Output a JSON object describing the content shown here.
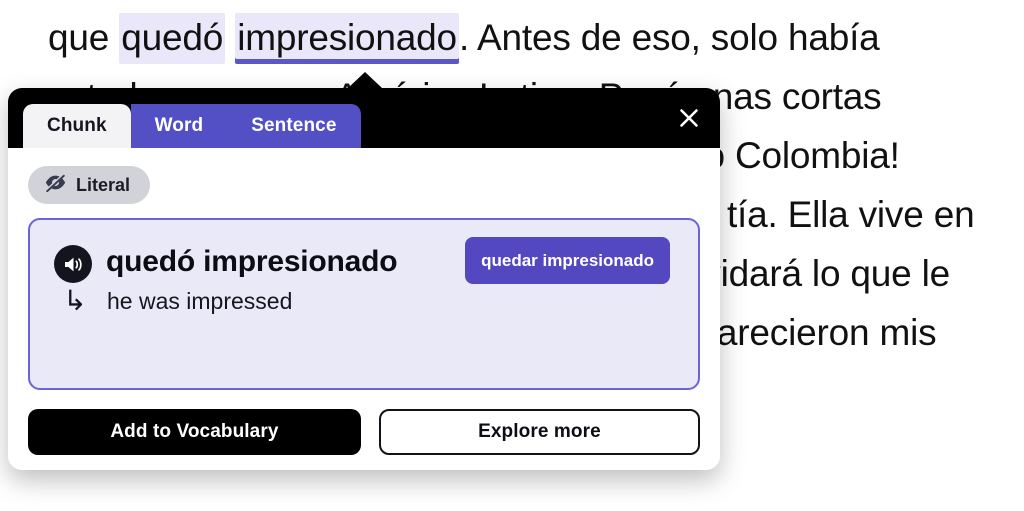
{
  "reader": {
    "segments": [
      {
        "text": "que ",
        "style": "plain"
      },
      {
        "text": "quedó",
        "style": "highlight"
      },
      {
        "text": " ",
        "style": "plain"
      },
      {
        "text": "impresionado",
        "style": "highlight-underline"
      },
      {
        "text": ". Antes de eso, solo había estado una vez a América Latina. Pasó unas cortas vacaciones en las playas de Tulum. ¡Pero Colombia! Cuando llegamos, fuimos a la casa de su tía. Ella vive en una región muy bella del país. ¡Nunca olvidará lo que le esperaba! Apenas llegamos a la casa, aparecieron mis",
        "style": "plain"
      }
    ],
    "highlight_color": "#e9e7f9",
    "underline_color": "#5b57c9"
  },
  "popup": {
    "header": {
      "tabs": [
        {
          "label": "Chunk",
          "active": true
        },
        {
          "label": "Word",
          "active": false
        },
        {
          "label": "Sentence",
          "active": false
        }
      ],
      "close_label": "✕",
      "background_color": "#000000",
      "tab_color": "#534fc4",
      "active_tab_color": "#f3f3f6"
    },
    "literal_chip": {
      "label": "Literal",
      "icon": "eye-off-icon",
      "background_color": "#d2d2d9"
    },
    "chunk_card": {
      "term": "quedó impresionado",
      "translation": "he was impressed",
      "translation_arrow": "↳",
      "speaker_icon": "speaker-icon",
      "lemma_badge": "quedar impresionado",
      "background_color": "#eae9f8",
      "border_color": "#6b63d8",
      "badge_color": "#5348c0"
    },
    "footer": {
      "primary_label": "Add to Vocabulary",
      "secondary_label": "Explore more"
    }
  }
}
